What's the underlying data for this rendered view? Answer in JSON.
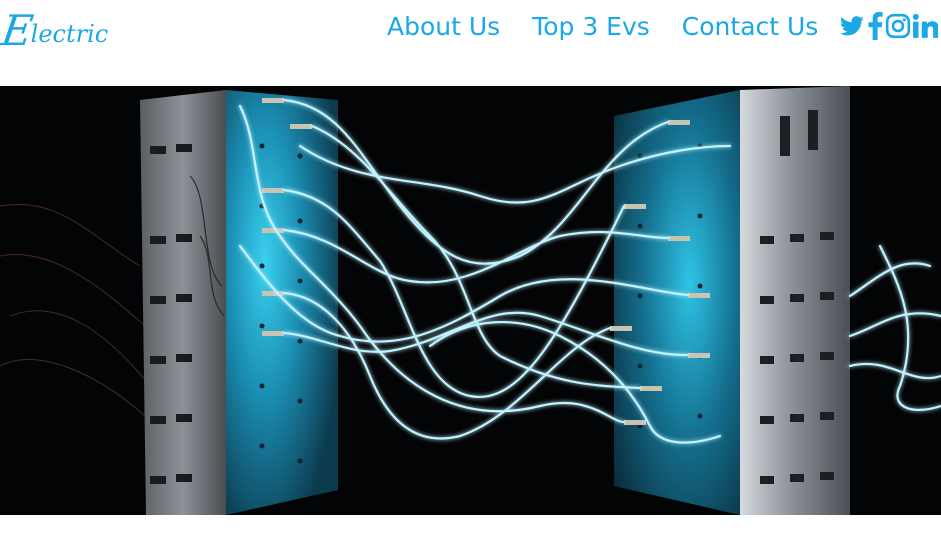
{
  "brand": {
    "first_letter": "E",
    "rest": "lectric"
  },
  "nav": {
    "links": [
      {
        "label": "About Us"
      },
      {
        "label": "Top 3 Evs"
      },
      {
        "label": "Contact Us"
      }
    ]
  },
  "social": {
    "icons": [
      "twitter-icon",
      "facebook-icon",
      "instagram-icon",
      "linkedin-icon"
    ]
  },
  "hero": {
    "description_icon": "electric-wires-image"
  },
  "colors": {
    "accent": "#1aa8e6",
    "glow": "#9fe8ff",
    "panel_left": "#7a7d84",
    "panel_teal": "#1c9fc4",
    "background": "#030405"
  }
}
